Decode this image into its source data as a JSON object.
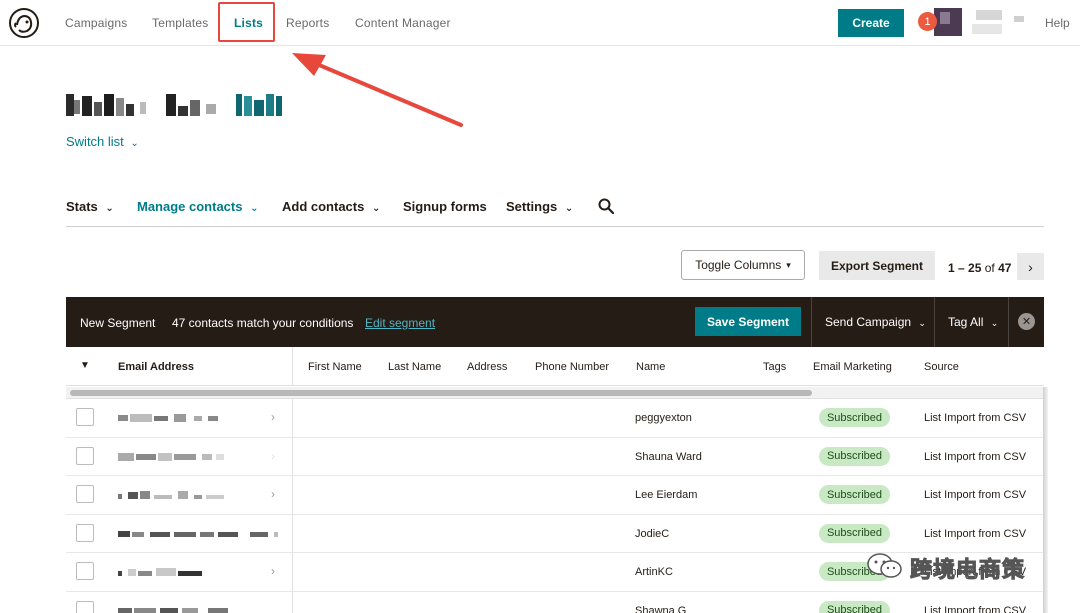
{
  "topnav": {
    "items": [
      "Campaigns",
      "Templates",
      "Lists",
      "Reports",
      "Content Manager"
    ],
    "create_label": "Create",
    "notification_count": "1",
    "help_label": "Help"
  },
  "list": {
    "switch_label": "Switch list"
  },
  "subnav": {
    "stats": "Stats",
    "manage_contacts": "Manage contacts",
    "add_contacts": "Add contacts",
    "signup_forms": "Signup forms",
    "settings": "Settings"
  },
  "toolbar": {
    "toggle_columns": "Toggle Columns",
    "export_segment": "Export Segment",
    "pager_range": "1 – 25",
    "pager_of": "of",
    "pager_total": "47"
  },
  "segment": {
    "title": "New Segment",
    "match_text": "47 contacts match your conditions",
    "edit_label": "Edit segment",
    "save_label": "Save Segment",
    "send_campaign": "Send Campaign",
    "tag_all": "Tag All"
  },
  "table": {
    "headers": [
      "Email Address",
      "First Name",
      "Last Name",
      "Address",
      "Phone Number",
      "Name",
      "Tags",
      "Email Marketing",
      "Source"
    ],
    "rows": [
      {
        "name": "peggyexton",
        "status": "Subscribed",
        "source": "List Import from CSV"
      },
      {
        "name": "Shauna Ward",
        "status": "Subscribed",
        "source": "List Import from CSV"
      },
      {
        "name": "Lee Eierdam",
        "status": "Subscribed",
        "source": "List Import from CSV"
      },
      {
        "name": "JodieC",
        "status": "Subscribed",
        "source": "List Import from CSV"
      },
      {
        "name": "ArtinKC",
        "status": "Subscribed",
        "source": "List Import from CSV"
      },
      {
        "name": "Shawna G",
        "status": "Subscribed",
        "source": "List Import from CSV"
      }
    ]
  },
  "watermark": {
    "text": "跨境电商策"
  },
  "colors": {
    "brand_teal": "#007c89",
    "dark_bar": "#241c15",
    "badge_green": "#c9e9c4",
    "annotation_red": "#e8473c"
  }
}
